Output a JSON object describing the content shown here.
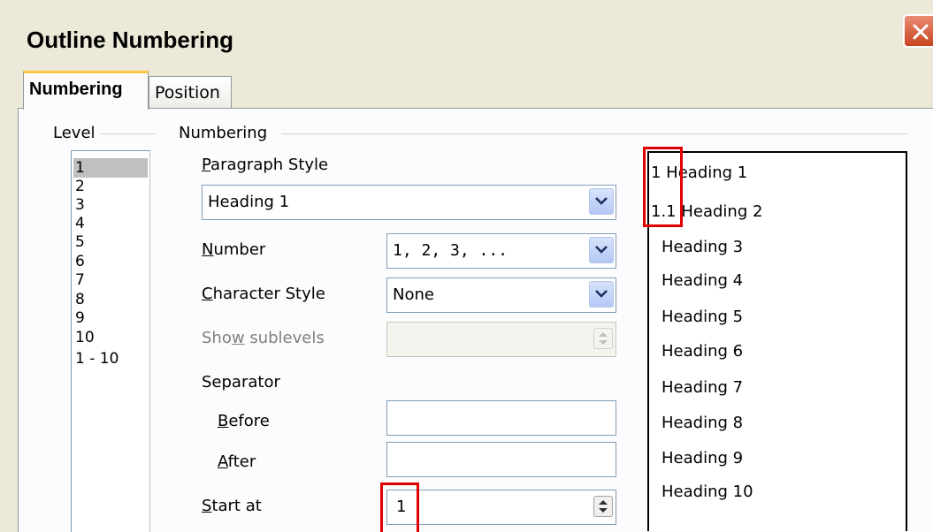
{
  "window": {
    "title": "Outline Numbering"
  },
  "tabs": [
    {
      "label": "Numbering",
      "active": true
    },
    {
      "label": "Position",
      "active": false
    }
  ],
  "level_group": {
    "label": "Level",
    "items": [
      "1",
      "2",
      "3",
      "4",
      "5",
      "6",
      "7",
      "8",
      "9",
      "10",
      "1 - 10"
    ],
    "selected": "1"
  },
  "numbering_group": {
    "label": "Numbering",
    "paragraph_style": {
      "label_pre": "",
      "label_u": "P",
      "label_post": "aragraph Style",
      "value": "Heading 1"
    },
    "number": {
      "label_u": "N",
      "label_post": "umber",
      "value": "1, 2, 3, ..."
    },
    "character_style": {
      "label_u": "C",
      "label_post": "haracter Style",
      "value": "None"
    },
    "show_sublevels": {
      "label_pre": "Sho",
      "label_u": "w",
      "label_post": " sublevels",
      "value": ""
    },
    "separator": {
      "label": "Separator",
      "before": {
        "label_u": "B",
        "label_post": "efore",
        "value": ""
      },
      "after": {
        "label_u": "A",
        "label_post": "fter",
        "value": ""
      }
    },
    "start_at": {
      "label_u": "S",
      "label_post": "tart at",
      "value": "1"
    }
  },
  "preview": {
    "lines": [
      "1 Heading 1",
      "1.1 Heading 2",
      "Heading 3",
      "Heading 4",
      "Heading 5",
      "Heading 6",
      "Heading 7",
      "Heading 8",
      "Heading 9",
      "Heading 10"
    ]
  },
  "colors": {
    "highlight": "#e00000",
    "dialog_bg": "#ece9d8",
    "panel_bg": "#fcfcfe",
    "tab_accent": "#ffc83c"
  }
}
